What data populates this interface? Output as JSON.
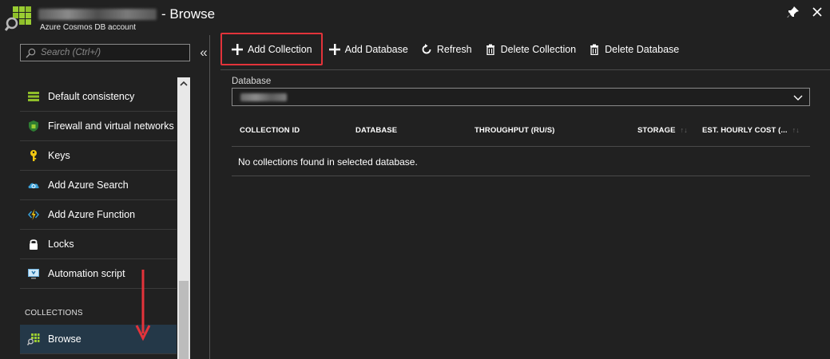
{
  "header": {
    "title": "- Browse",
    "subtitle": "Azure Cosmos DB account"
  },
  "sidebar": {
    "search_placeholder": "Search (Ctrl+/)",
    "collapse_glyph": "«",
    "items": [
      {
        "label": "Default consistency",
        "icon": "consistency-icon"
      },
      {
        "label": "Firewall and virtual networks",
        "icon": "firewall-icon"
      },
      {
        "label": "Keys",
        "icon": "key-icon"
      },
      {
        "label": "Add Azure Search",
        "icon": "azure-search-icon"
      },
      {
        "label": "Add Azure Function",
        "icon": "azure-function-icon"
      },
      {
        "label": "Locks",
        "icon": "lock-icon"
      },
      {
        "label": "Automation script",
        "icon": "automation-script-icon"
      }
    ],
    "section_header": "COLLECTIONS",
    "active_item": {
      "label": "Browse",
      "icon": "browse-icon"
    }
  },
  "toolbar": {
    "add_collection": "Add Collection",
    "add_database": "Add Database",
    "refresh": "Refresh",
    "delete_collection": "Delete Collection",
    "delete_database": "Delete Database"
  },
  "database_field": {
    "label": "Database"
  },
  "table": {
    "columns": [
      "COLLECTION ID",
      "DATABASE",
      "THROUGHPUT (RU/S)",
      "STORAGE",
      "EST. HOURLY COST (..."
    ],
    "empty_message": "No collections found in selected database."
  },
  "colors": {
    "background": "#212121",
    "active_item": "#243848",
    "highlight_border": "#e3333a",
    "accent_green": "#9acd32"
  }
}
